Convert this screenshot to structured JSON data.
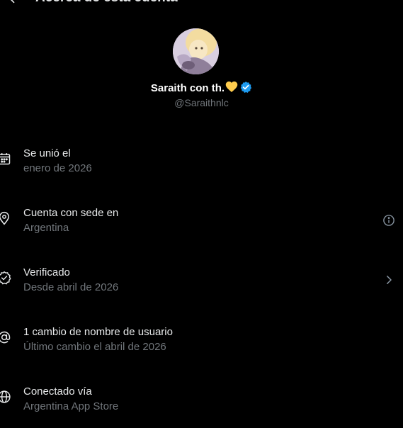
{
  "header": {
    "title": "Acerca de esta cuenta"
  },
  "profile": {
    "display_name": "Saraith con th.",
    "handle": "@Saraithnlc",
    "verified_color": "#1d9bf0",
    "heart_color": "#ffcc4d"
  },
  "rows": [
    {
      "icon": "calendar-icon",
      "title": "Se unió el",
      "subtitle": "enero de 2026"
    },
    {
      "icon": "location-pin-icon",
      "title": "Cuenta con sede en",
      "subtitle": "Argentina",
      "trailing": "info-icon"
    },
    {
      "icon": "verified-check-icon",
      "title": "Verificado",
      "subtitle": "Desde abril de 2026",
      "trailing": "chevron-right-icon"
    },
    {
      "icon": "at-sign-icon",
      "title": "1 cambio de nombre de usuario",
      "subtitle": "Último cambio el abril de 2026"
    },
    {
      "icon": "globe-icon",
      "title": "Conectado vía",
      "subtitle": "Argentina App Store"
    }
  ],
  "colors": {
    "background": "#000000",
    "primary_text": "#e7e9ea",
    "secondary_text": "#71767b"
  }
}
